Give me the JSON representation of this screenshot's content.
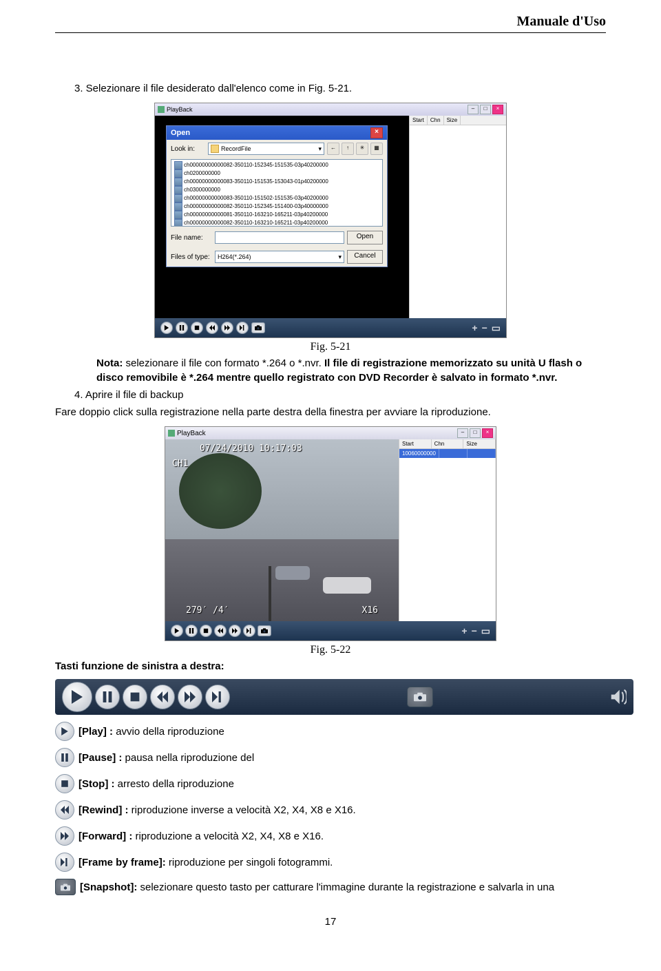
{
  "header": {
    "title": "Manuale d'Uso"
  },
  "section": {
    "item3": "3.   Selezionare il file desiderato dall'elenco come in Fig. 5-21.",
    "fig1_caption": "Fig. 5-21",
    "note_label": "Nota:",
    "note_text": " selezionare il file con formato *.264 o *.nvr. ",
    "note_bold2": "Il file di registrazione memorizzato su unità U flash o disco removibile è *.264 mentre quello registrato con DVD Recorder è salvato in formato *.nvr.",
    "item4": "4.   Aprire il file di backup",
    "item4_text": "Fare doppio click sulla registrazione nella parte destra della finestra per avviare la riproduzione.",
    "fig2_caption": "Fig. 5-22",
    "toolbar_label": "Tasti funzione de sinistra a destra:"
  },
  "screenshot1": {
    "window_title": "PlayBack",
    "right_cols": {
      "c1": "Start",
      "c2": "Chn",
      "c3": "Size"
    },
    "dialog": {
      "title": "Open",
      "lookin_label": "Look in:",
      "lookin_value": "RecordFile",
      "files": [
        "ch00000000000082-350110-152345-151535-03p40200000",
        "ch00000000000083-350110-151535-153043-01p40200000",
        "ch00000000000083-350110-151502-151535-03p40200000",
        "ch00000000000082-350110-152345-151400-03p40000000",
        "ch00000000000081-350110-163210-165211-03p40200000",
        "ch00000000000082-350110-163210-165211-03p40200000",
        "ch0200000000",
        "ch0300000000"
      ],
      "filename_label": "File name:",
      "filename_value": "",
      "filetype_label": "Files of type:",
      "filetype_value": "H264(*.264)",
      "open_btn": "Open",
      "cancel_btn": "Cancel"
    }
  },
  "screenshot2": {
    "window_title": "PlayBack",
    "timestamp": "07/24/2010 10:17:03",
    "channel": "CH1",
    "osd_left": "279′ /4′",
    "osd_right": "X16",
    "right_cols": {
      "c1": "Start",
      "c2": "Chn",
      "c3": "Size"
    },
    "row": {
      "c1": "10060000000",
      "c2": "",
      "c3": ""
    }
  },
  "buttons": {
    "play": {
      "label_bold": "[Play] : ",
      "label": "avvio della riproduzione"
    },
    "pause": {
      "label_bold": "[Pause] : ",
      "label": "pausa nella riproduzione del"
    },
    "stop": {
      "label_bold": "[Stop] : ",
      "label": "arresto della riproduzione"
    },
    "rewind": {
      "label_bold": "[Rewind] : ",
      "label": "riproduzione inverse a velocità X2, X4, X8 e X16."
    },
    "forward": {
      "label_bold": "[Forward] : ",
      "label": "riproduzione a velocità X2, X4, X8 e X16."
    },
    "frame": {
      "label_bold": "[Frame by frame]: ",
      "label": "riproduzione per singoli fotogrammi."
    },
    "snapshot": {
      "label_bold": "[Snapshot]: ",
      "label": "selezionare questo tasto per catturare l'immagine durante la registrazione e salvarla in una"
    }
  },
  "page_number": "17"
}
